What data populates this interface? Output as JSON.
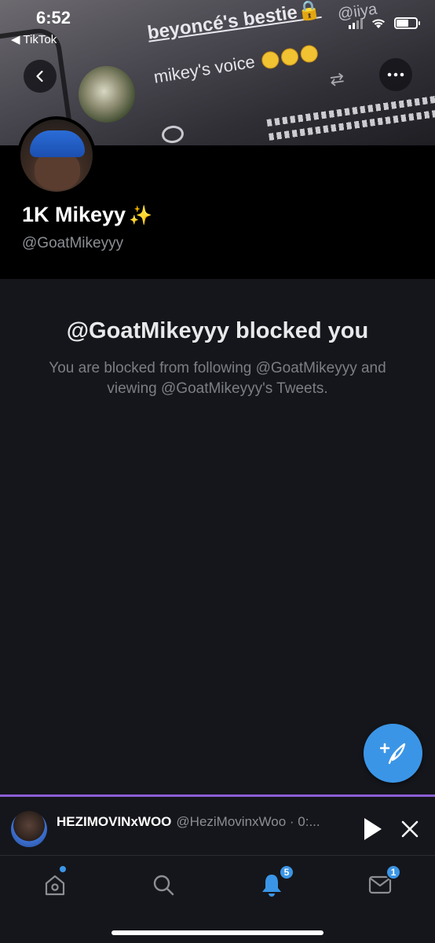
{
  "status_bar": {
    "time": "6:52",
    "back_app": "◀ TikTok"
  },
  "banner": {
    "tweet_name": "beyoncé's bestie🔒",
    "tweet_handle": "@iiya",
    "tweet_text": "mikey's voice"
  },
  "profile": {
    "display_name": "1K Mikeyy",
    "sparkles": "✨",
    "handle": "@GoatMikeyyy"
  },
  "blocked": {
    "title": "@GoatMikeyyy blocked you",
    "description": "You are blocked from following @GoatMikeyyy and viewing @GoatMikeyyy's Tweets."
  },
  "mini_player": {
    "name": "HEZIMOVINxWOO",
    "meta": "@HeziMovinxWoo · 0:..."
  },
  "tab_bar": {
    "notifications_badge": "5",
    "messages_badge": "1"
  },
  "colors": {
    "accent": "#3b95e6",
    "player_border": "#8b5ed8",
    "background": "#15161b"
  },
  "icons": [
    "back-arrow-icon",
    "more-icon",
    "compose-icon",
    "play-icon",
    "close-icon",
    "home-icon",
    "search-icon",
    "bell-icon",
    "mail-icon"
  ]
}
